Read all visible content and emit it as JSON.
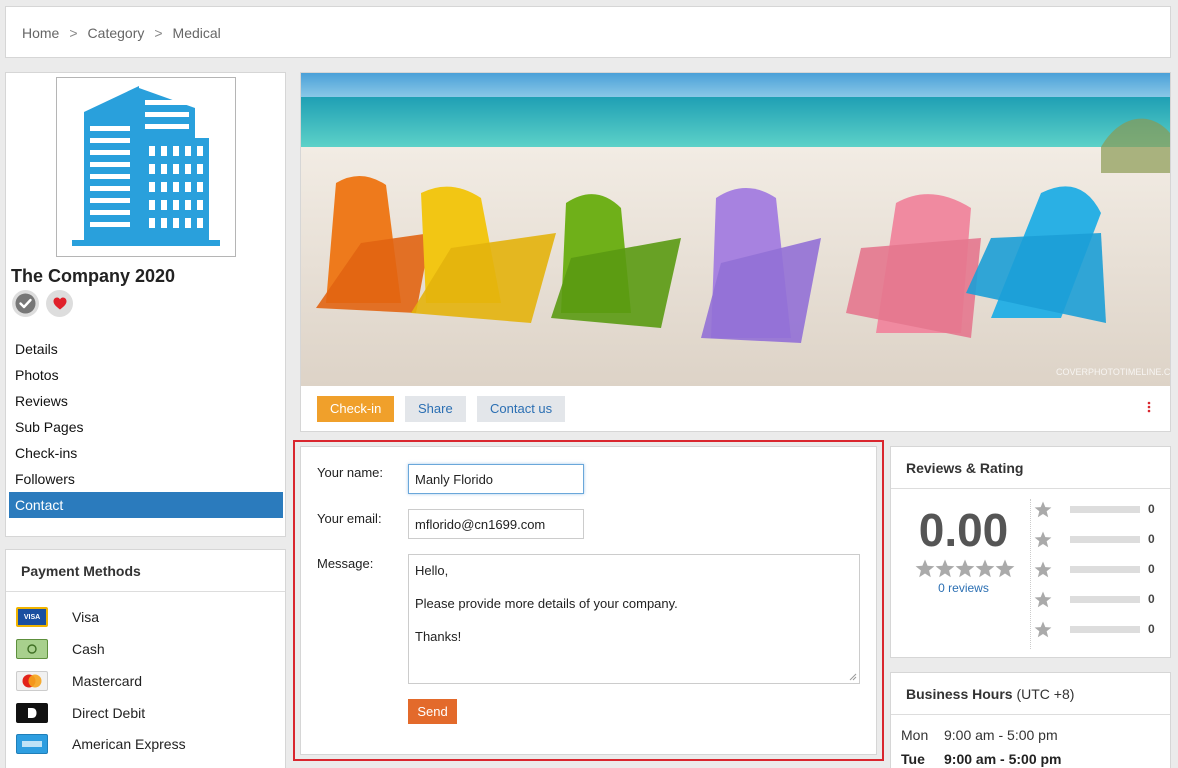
{
  "breadcrumb": {
    "items": [
      "Home",
      "Category",
      "Medical"
    ],
    "separator": ">"
  },
  "profile": {
    "company_name": "The Company 2020",
    "nav": [
      "Details",
      "Photos",
      "Reviews",
      "Sub Pages",
      "Check-ins",
      "Followers",
      "Contact"
    ],
    "active_nav": "Contact"
  },
  "payment": {
    "title": "Payment Methods",
    "methods": [
      {
        "label": "Visa",
        "icon": "visa-icon"
      },
      {
        "label": "Cash",
        "icon": "cash-icon"
      },
      {
        "label": "Mastercard",
        "icon": "mastercard-icon"
      },
      {
        "label": "Direct Debit",
        "icon": "direct-debit-icon"
      },
      {
        "label": "American Express",
        "icon": "amex-icon"
      }
    ]
  },
  "cover": {
    "watermark": "COVERPHOTOTIMELINE.COM",
    "actions": {
      "checkin": "Check-in",
      "share": "Share",
      "contact": "Contact us"
    }
  },
  "contact_form": {
    "name_label": "Your name:",
    "name_value": "Manly Florido",
    "email_label": "Your email:",
    "email_value": "mflorido@cn1699.com",
    "message_label": "Message:",
    "message_lines": [
      "Hello,",
      "Please provide more details of your company.",
      "Thanks!"
    ],
    "send_label": "Send"
  },
  "reviews": {
    "title": "Reviews & Rating",
    "score": "0.00",
    "reviews_link": "0 reviews",
    "breakdown": [
      0,
      0,
      0,
      0,
      0
    ]
  },
  "hours": {
    "title": "Business Hours",
    "timezone": "(UTC +8)",
    "rows": [
      {
        "day": "Mon",
        "time": "9:00 am - 5:00 pm",
        "today": false
      },
      {
        "day": "Tue",
        "time": "9:00 am - 5:00 pm",
        "today": true
      }
    ]
  },
  "colors": {
    "accent": "#2b7bbd",
    "checkin": "#f0a02b",
    "send": "#e36a2b",
    "highlight": "#d9262e",
    "logo": "#29a0dc"
  }
}
